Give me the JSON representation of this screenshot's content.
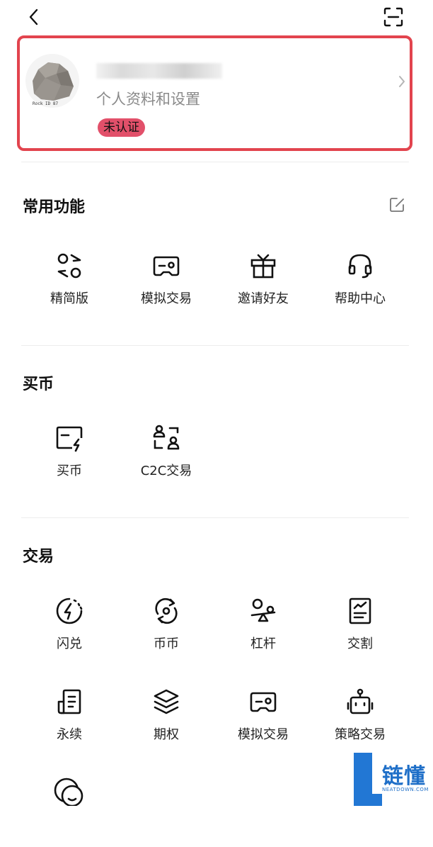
{
  "profile": {
    "subtitle": "个人资料和设置",
    "badge": "未认证",
    "avatar_caption": "Rock ID 87"
  },
  "sections": {
    "common": {
      "title": "常用功能",
      "items": [
        {
          "label": "精简版",
          "icon": "lite-version-icon"
        },
        {
          "label": "模拟交易",
          "icon": "gamepad-icon"
        },
        {
          "label": "邀请好友",
          "icon": "gift-icon"
        },
        {
          "label": "帮助中心",
          "icon": "headset-icon"
        }
      ]
    },
    "buy": {
      "title": "买币",
      "items": [
        {
          "label": "买币",
          "icon": "card-lightning-icon"
        },
        {
          "label": "C2C交易",
          "icon": "users-exchange-icon"
        }
      ]
    },
    "trade": {
      "title": "交易",
      "items": [
        {
          "label": "闪兑",
          "icon": "flash-swap-icon"
        },
        {
          "label": "币币",
          "icon": "refresh-coin-icon"
        },
        {
          "label": "杠杆",
          "icon": "leverage-icon"
        },
        {
          "label": "交割",
          "icon": "document-chart-icon"
        },
        {
          "label": "永续",
          "icon": "perpetual-icon"
        },
        {
          "label": "期权",
          "icon": "layers-icon"
        },
        {
          "label": "模拟交易",
          "icon": "gamepad-icon"
        },
        {
          "label": "策略交易",
          "icon": "robot-icon"
        },
        {
          "label": "",
          "icon": "coins-icon"
        }
      ]
    }
  },
  "watermark": {
    "text": "链懂",
    "sub": "NEATDOWN.COM"
  },
  "colors": {
    "highlight_border": "#e2444e",
    "badge_bg": "#e2506a",
    "watermark_blue": "#2277d4"
  }
}
